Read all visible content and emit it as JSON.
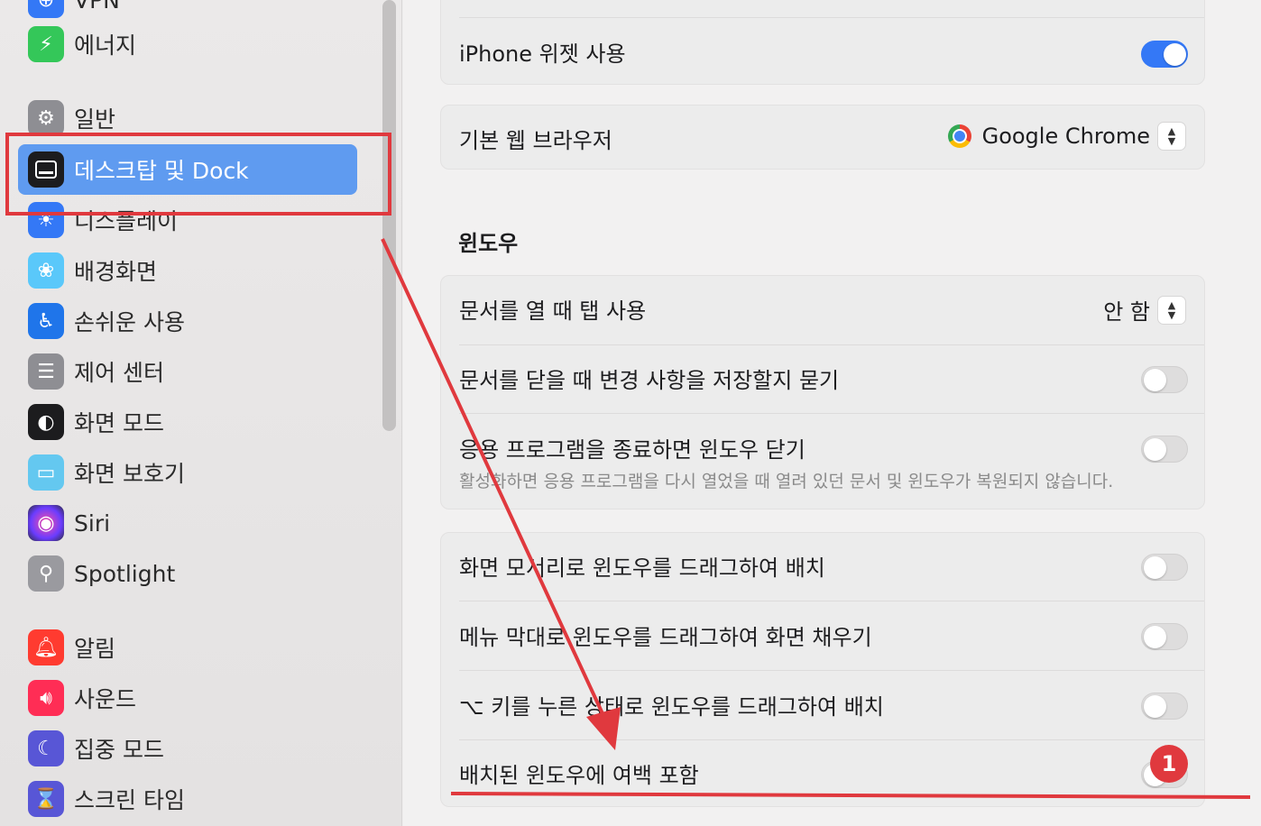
{
  "sidebar": {
    "items": [
      {
        "label": "VPN",
        "icon": "vpn-icon",
        "color": "#3478f6"
      },
      {
        "label": "에너지",
        "icon": "bolt-icon",
        "color": "#34c759"
      },
      {
        "label": "일반",
        "icon": "gear-icon",
        "color": "#8e8e93"
      },
      {
        "label": "데스크탑 및 Dock",
        "icon": "dock-icon",
        "color": "#1c1c1e"
      },
      {
        "label": "디스플레이",
        "icon": "sun-icon",
        "color": "#3478f6"
      },
      {
        "label": "배경화면",
        "icon": "flower-icon",
        "color": "#5ac8fa"
      },
      {
        "label": "손쉬운 사용",
        "icon": "accessibility-icon",
        "color": "#1f75ea"
      },
      {
        "label": "제어 센터",
        "icon": "toggles-icon",
        "color": "#8e8e93"
      },
      {
        "label": "화면 모드",
        "icon": "appearance-icon",
        "color": "#1c1c1e"
      },
      {
        "label": "화면 보호기",
        "icon": "screensaver-icon",
        "color": "#64c8f0"
      },
      {
        "label": "Siri",
        "icon": "siri-icon",
        "color": "#2b2b3a"
      },
      {
        "label": "Spotlight",
        "icon": "magnifier-icon",
        "color": "#9a9a9f"
      },
      {
        "label": "알림",
        "icon": "bell-icon",
        "color": "#ff3b30"
      },
      {
        "label": "사운드",
        "icon": "speaker-icon",
        "color": "#ff2d55"
      },
      {
        "label": "집중 모드",
        "icon": "moon-icon",
        "color": "#5856d6"
      },
      {
        "label": "스크린 타임",
        "icon": "hourglass-icon",
        "color": "#5856d6"
      }
    ],
    "selected_index": 3
  },
  "main": {
    "iphone_widget": {
      "label": "iPhone 위젯 사용",
      "enabled": true
    },
    "default_browser": {
      "label": "기본 웹 브라우저",
      "value": "Google Chrome"
    },
    "window_section_title": "윈도우",
    "tabs_row": {
      "label": "문서를 열 때 탭 사용",
      "value": "안 함"
    },
    "ask_save": {
      "label": "문서를 닫을 때 변경 사항을 저장할지 묻기",
      "enabled": false
    },
    "close_windows": {
      "label": "응용 프로그램을 종료하면 윈도우 닫기",
      "description": "활성화하면 응용 프로그램을 다시 열었을 때 열려 있던 문서 및 윈도우가 복원되지 않습니다.",
      "enabled": false
    },
    "tiling": [
      {
        "label": "화면 모서리로 윈도우를 드래그하여 배치",
        "enabled": false
      },
      {
        "label": "메뉴 막대로 윈도우를 드래그하여 화면 채우기",
        "enabled": false
      },
      {
        "label": "⌥ 키를 누른 상태로 윈도우를 드래그하여 배치",
        "enabled": false
      },
      {
        "label": "배치된 윈도우에 여백 포함",
        "enabled": false
      }
    ]
  },
  "annotation": {
    "badge": "1",
    "color": "#e0393e"
  }
}
